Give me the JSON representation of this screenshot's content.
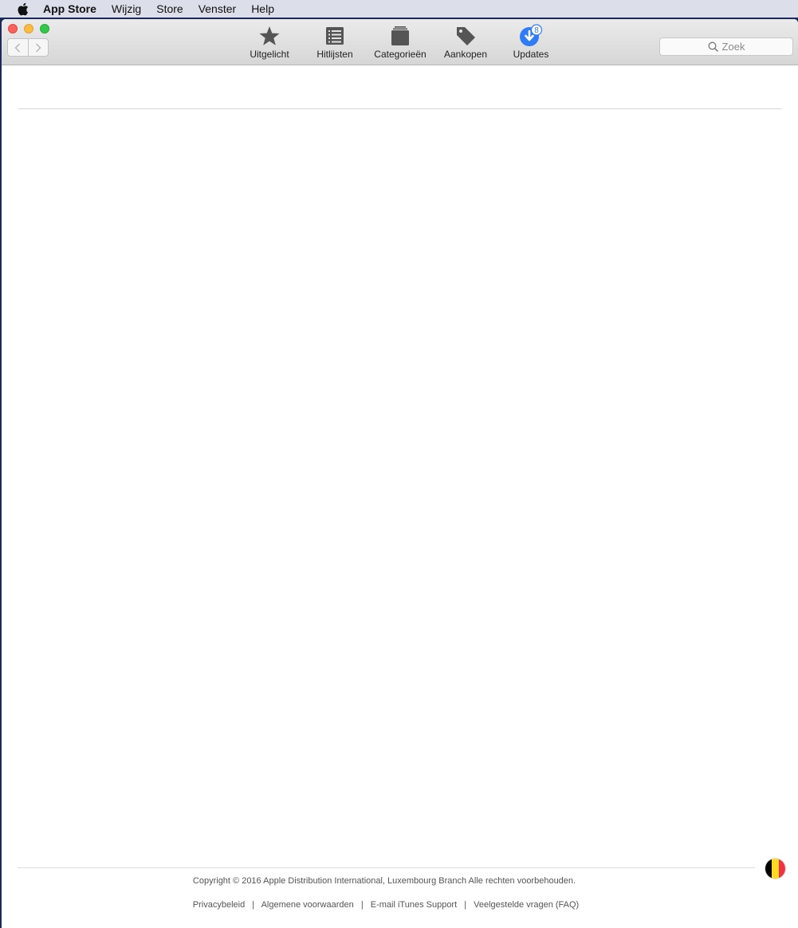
{
  "menubar": {
    "apple_icon": "apple-icon",
    "items": [
      "App Store",
      "Wijzig",
      "Store",
      "Venster",
      "Help"
    ]
  },
  "toolbar": {
    "featured_label": "Uitgelicht",
    "charts_label": "Hitlijsten",
    "categories_label": "Categorieën",
    "purchases_label": "Aankopen",
    "updates_label": "Updates",
    "updates_badge": "8",
    "updates_color": "#2f7cf6"
  },
  "search": {
    "placeholder": "Zoek"
  },
  "footer": {
    "copyright": "Copyright © 2016 Apple Distribution International, Luxembourg Branch Alle rechten voorbehouden.",
    "links": [
      "Privacybeleid",
      "Algemene voorwaarden",
      "E-mail iTunes Support",
      "Veelgestelde vragen (FAQ)"
    ],
    "separator": "|",
    "flag_colors": [
      "#000000",
      "#fdda24",
      "#ef3340"
    ]
  }
}
